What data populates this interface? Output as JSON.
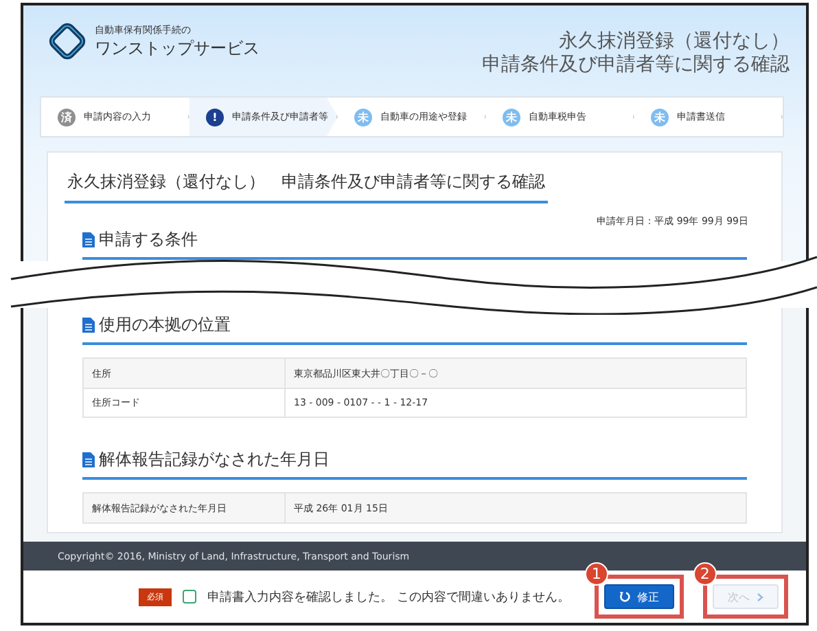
{
  "header": {
    "logo_small": "自動車保有関係手続の",
    "logo_large": "ワンストップサービス",
    "title_line1": "永久抹消登録（還付なし）",
    "title_line2": "申請条件及び申請者等に関する確認"
  },
  "steps": [
    {
      "kind": "done",
      "badge": "済",
      "label": "申請内容の入力",
      "selected": false
    },
    {
      "kind": "current",
      "badge": "!",
      "label": "申請条件及び申請者等",
      "selected": true
    },
    {
      "kind": "pending",
      "badge": "未",
      "label": "自動車の用途や登録",
      "selected": false
    },
    {
      "kind": "pending",
      "badge": "未",
      "label": "自動車税申告",
      "selected": false
    },
    {
      "kind": "pending",
      "badge": "未",
      "label": "申請書送信",
      "selected": false
    }
  ],
  "page_title": "永久抹消登録（還付なし）　申請条件及び申請者等に関する確認",
  "application_date": "申請年月日：平成 99年 99月 99日",
  "sections_top": [
    {
      "heading": "申請する条件"
    }
  ],
  "sections": [
    {
      "heading": "使用の本拠の位置",
      "rows": [
        {
          "label": "住所",
          "value": "東京都品川区東大井〇丁目〇－〇"
        },
        {
          "label": "住所コード",
          "value": "13 - 009 - 0107 -  - 1 - 12-17"
        }
      ]
    },
    {
      "heading": "解体報告記録がなされた年月日",
      "rows": [
        {
          "label": "解体報告記録がなされた年月日",
          "value": "平成 26年 01月 15日"
        }
      ]
    }
  ],
  "footer": {
    "copyright": "Copyright© 2016, Ministry of Land, Infrastructure, Transport and Tourism"
  },
  "confirm": {
    "required_tag": "必須",
    "checked": false,
    "label": "申請書入力内容を確認しました。 この内容で間違いありません。"
  },
  "buttons": [
    {
      "kind": "primary",
      "label": "修正",
      "callout": "1",
      "disabled": false
    },
    {
      "kind": "next",
      "label": "次へ",
      "callout": "2",
      "disabled": true
    }
  ]
}
